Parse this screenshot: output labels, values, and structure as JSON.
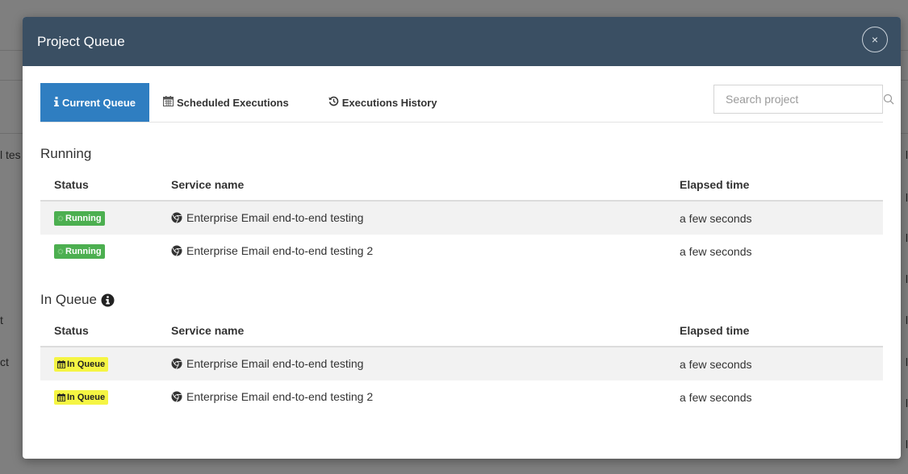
{
  "background": {
    "left_fragments": [
      "l tes",
      "t",
      "ct"
    ],
    "right_fragments": [
      "l",
      "l",
      "l",
      "l",
      "l",
      "l",
      "l",
      "l"
    ]
  },
  "modal": {
    "title": "Project Queue",
    "close_glyph": "×"
  },
  "tabs": [
    {
      "label": "Current Queue",
      "icon": "info-icon",
      "active": true
    },
    {
      "label": "Scheduled Executions",
      "icon": "calendar-icon",
      "active": false
    },
    {
      "label": "Executions History",
      "icon": "history-icon",
      "active": false
    }
  ],
  "search": {
    "placeholder": "Search project",
    "value": ""
  },
  "running": {
    "title": "Running",
    "columns": [
      "Status",
      "Service name",
      "Elapsed time"
    ],
    "rows": [
      {
        "status": "Running",
        "service": "Enterprise Email end-to-end testing",
        "elapsed": "a few seconds"
      },
      {
        "status": "Running",
        "service": "Enterprise Email end-to-end testing 2",
        "elapsed": "a few seconds"
      }
    ]
  },
  "in_queue": {
    "title": "In Queue",
    "columns": [
      "Status",
      "Service name",
      "Elapsed time"
    ],
    "rows": [
      {
        "status": "In Queue",
        "service": "Enterprise Email end-to-end testing",
        "elapsed": "a few seconds"
      },
      {
        "status": "In Queue",
        "service": "Enterprise Email end-to-end testing 2",
        "elapsed": "a few seconds"
      }
    ]
  },
  "colors": {
    "header": "#3a4f63",
    "active_tab": "#2f7ec1",
    "running_badge": "#4caf50",
    "queue_badge": "#f5f543"
  }
}
